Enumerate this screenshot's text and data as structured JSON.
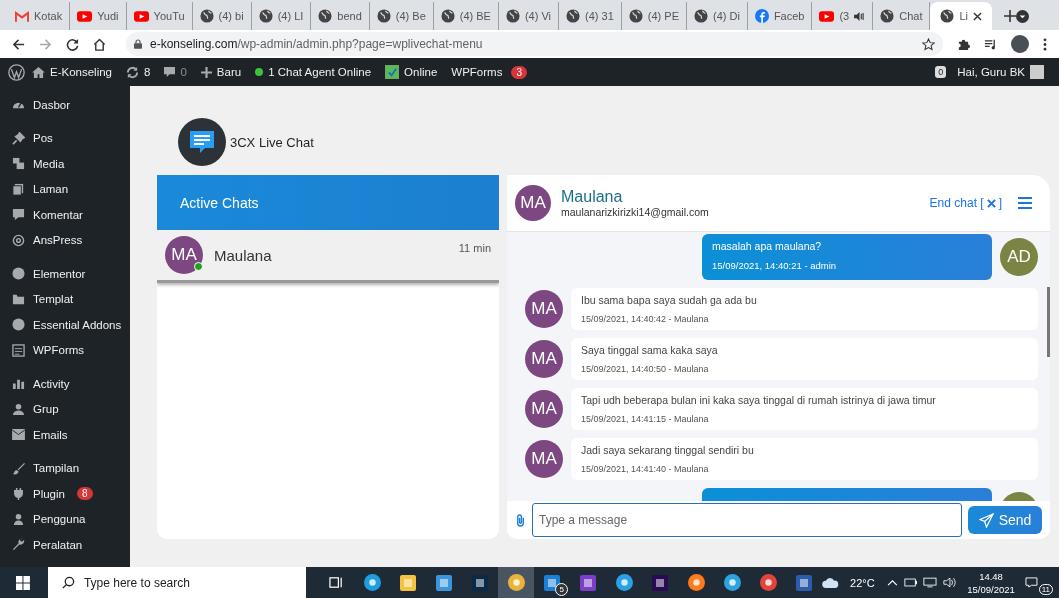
{
  "browser": {
    "tabs": [
      {
        "title": "Kotak",
        "kind": "gmail",
        "selected": false,
        "audio": false
      },
      {
        "title": "Yudi",
        "kind": "youtube",
        "selected": false,
        "audio": false
      },
      {
        "title": "YouTu",
        "kind": "youtube",
        "selected": false,
        "audio": false
      },
      {
        "title": "(4) bi",
        "kind": "globe",
        "selected": false,
        "audio": false
      },
      {
        "title": "(4) LI",
        "kind": "globe",
        "selected": false,
        "audio": false
      },
      {
        "title": "bend",
        "kind": "globe",
        "selected": false,
        "audio": false
      },
      {
        "title": "(4) Be",
        "kind": "globe",
        "selected": false,
        "audio": false
      },
      {
        "title": "(4) BE",
        "kind": "globe",
        "selected": false,
        "audio": false
      },
      {
        "title": "(4) Vi",
        "kind": "globe",
        "selected": false,
        "audio": false
      },
      {
        "title": "(4) 31",
        "kind": "globe",
        "selected": false,
        "audio": false
      },
      {
        "title": "(4) PE",
        "kind": "globe",
        "selected": false,
        "audio": false
      },
      {
        "title": "(4) Di",
        "kind": "globe",
        "selected": false,
        "audio": false
      },
      {
        "title": "Faceb",
        "kind": "facebook",
        "selected": false,
        "audio": false
      },
      {
        "title": "(3",
        "kind": "youtube",
        "selected": false,
        "audio": true
      },
      {
        "title": "Chat",
        "kind": "globe",
        "selected": false,
        "audio": false
      },
      {
        "title": "Li",
        "kind": "globe",
        "selected": true,
        "audio": false
      }
    ],
    "url_host": "e-konseling.com",
    "url_path": "/wp-admin/admin.php?page=wplivechat-menu"
  },
  "admin_bar": {
    "site": "E-Konseling",
    "updates": "8",
    "comments": "0",
    "new": "Baru",
    "agents": "1 Chat Agent Online",
    "online_label": "Online",
    "online": true,
    "wpforms": "WPForms",
    "wpforms_badge": "3",
    "notifications": "0",
    "greeting": "Hai, Guru BK"
  },
  "sidebar": {
    "groups": [
      {
        "items": [
          {
            "label": "Dasbor",
            "kind": "gauge"
          }
        ]
      },
      {
        "items": [
          {
            "label": "Pos",
            "kind": "pin"
          },
          {
            "label": "Media",
            "kind": "media"
          },
          {
            "label": "Laman",
            "kind": "page"
          },
          {
            "label": "Komentar",
            "kind": "comment"
          },
          {
            "label": "AnsPress",
            "kind": "at"
          }
        ]
      },
      {
        "items": [
          {
            "label": "Elementor",
            "kind": "circle"
          },
          {
            "label": "Templat",
            "kind": "folder"
          },
          {
            "label": "Essential Addons",
            "kind": "circle"
          },
          {
            "label": "WPForms",
            "kind": "form"
          }
        ]
      },
      {
        "items": [
          {
            "label": "Activity",
            "kind": "activity"
          },
          {
            "label": "Grup",
            "kind": "group"
          },
          {
            "label": "Emails",
            "kind": "mail"
          }
        ]
      },
      {
        "items": [
          {
            "label": "Tampilan",
            "kind": "brush"
          },
          {
            "label": "Plugin",
            "kind": "plug",
            "badge": "8"
          },
          {
            "label": "Pengguna",
            "kind": "person"
          },
          {
            "label": "Peralatan",
            "kind": "wrench"
          }
        ]
      }
    ]
  },
  "plugin": {
    "title": "3CX Live Chat"
  },
  "active_chats": {
    "title": "Active Chats",
    "items": [
      {
        "initials": "MA",
        "name": "Maulana",
        "time": "11 min",
        "online": true,
        "selected": true
      }
    ]
  },
  "chat": {
    "initials": "MA",
    "name": "Maulana",
    "email": "maulanarizkirizki14@gmail.com",
    "end_chat": "End chat [",
    "end_chat_close": "]",
    "messages": [
      {
        "kind": "admin",
        "initials": "AD",
        "text": "masalah apa maulana?",
        "meta": "15/09/2021, 14:40:21 - admin"
      },
      {
        "kind": "visitor",
        "initials": "MA",
        "text": "Ibu sama bapa saya sudah ga ada bu",
        "meta": "15/09/2021, 14:40:42 - Maulana"
      },
      {
        "kind": "visitor",
        "initials": "MA",
        "text": "Saya tinggal sama kaka saya",
        "meta": "15/09/2021, 14:40:50 - Maulana"
      },
      {
        "kind": "visitor",
        "initials": "MA",
        "text": "Tapi udh beberapa bulan ini kaka saya tinggal di rumah istrinya di jawa timur",
        "meta": "15/09/2021, 14:41:15 - Maulana"
      },
      {
        "kind": "visitor",
        "initials": "MA",
        "text": "Jadi saya sekarang tinggal sendiri bu",
        "meta": "15/09/2021, 14:41:40 - Maulana"
      },
      {
        "kind": "admin"
      }
    ],
    "composer": {
      "placeholder": "Type a message",
      "send": "Send"
    }
  },
  "taskbar": {
    "search_placeholder": "Type here to search",
    "apps": [
      {
        "kind": "taskview",
        "selected": false
      },
      {
        "kind": "edge",
        "selected": false
      },
      {
        "kind": "explorer",
        "selected": false
      },
      {
        "kind": "store",
        "selected": false
      },
      {
        "kind": "photoshop",
        "selected": false
      },
      {
        "kind": "chrome",
        "selected": true
      },
      {
        "kind": "mail",
        "selected": false,
        "badge": "5"
      },
      {
        "kind": "vs",
        "selected": false
      },
      {
        "kind": "robot",
        "selected": false
      },
      {
        "kind": "premiere",
        "selected": false
      },
      {
        "kind": "firefox",
        "selected": false
      },
      {
        "kind": "telegram",
        "selected": false
      },
      {
        "kind": "wheel",
        "selected": false
      },
      {
        "kind": "word",
        "selected": false
      }
    ],
    "weather": "22°C",
    "time": "14.48",
    "date": "15/09/2021",
    "notifications": "11"
  }
}
